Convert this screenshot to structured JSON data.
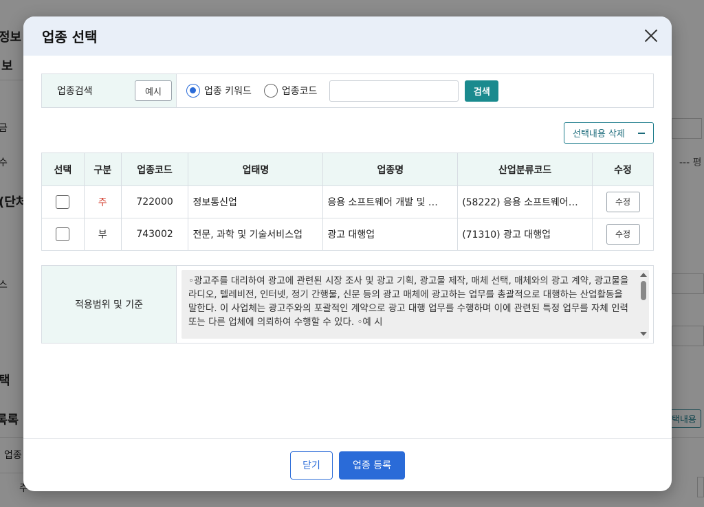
{
  "background": {
    "frag1": "정보",
    "frag2": "보",
    "frag3": "금",
    "frag4": "수",
    "frag5": "(단처",
    "frag6": "스",
    "frag7": "택",
    "frag8": "록록",
    "frag9": "업종",
    "frag10": "주",
    "right_text": "--- 평",
    "right_button": "택내용"
  },
  "modal": {
    "title": "업종 선택",
    "search": {
      "label": "업종검색",
      "example_button": "예시",
      "radio_keyword": "업종 키워드",
      "radio_code": "업종코드",
      "input_value": "",
      "input_placeholder": "",
      "search_button": "검색"
    },
    "clear_button": "선택내용 삭제",
    "table": {
      "headers": [
        "선택",
        "구분",
        "업종코드",
        "업태명",
        "업종명",
        "산업분류코드",
        "수정"
      ],
      "rows": [
        {
          "type": "주",
          "code": "722000",
          "business": "정보통신업",
          "industry": "응용 소프트웨어 개발 및 …",
          "class_code": "(58222) 응용 소프트웨어…",
          "edit": "수정"
        },
        {
          "type": "부",
          "code": "743002",
          "business": "전문, 과학 및 기술서비스업",
          "industry": "광고 대행업",
          "class_code": "(71310) 광고 대행업",
          "edit": "수정"
        }
      ]
    },
    "scope": {
      "label": "적용범위 및 기준",
      "text": "◦광고주를 대리하여 광고에 관련된 시장 조사 및 광고 기획, 광고물 제작, 매체 선택, 매체와의 광고 계약, 광고물을 라디오, 텔레비전, 인터넷, 정기 간행물, 신문 등의 광고 매체에 광고하는 업무를 총괄적으로 대행하는 산업활동을 말한다. 이 사업체는 광고주와의 포괄적인 계약으로 광고 대행 업무를 수행하며 이에 관련된 특정 업무를 자체 인력 또는 다른 업체에 의뢰하여 수행할 수 있다. ◦예 시"
    },
    "footer": {
      "close_button": "닫기",
      "register_button": "업종 등록"
    }
  }
}
